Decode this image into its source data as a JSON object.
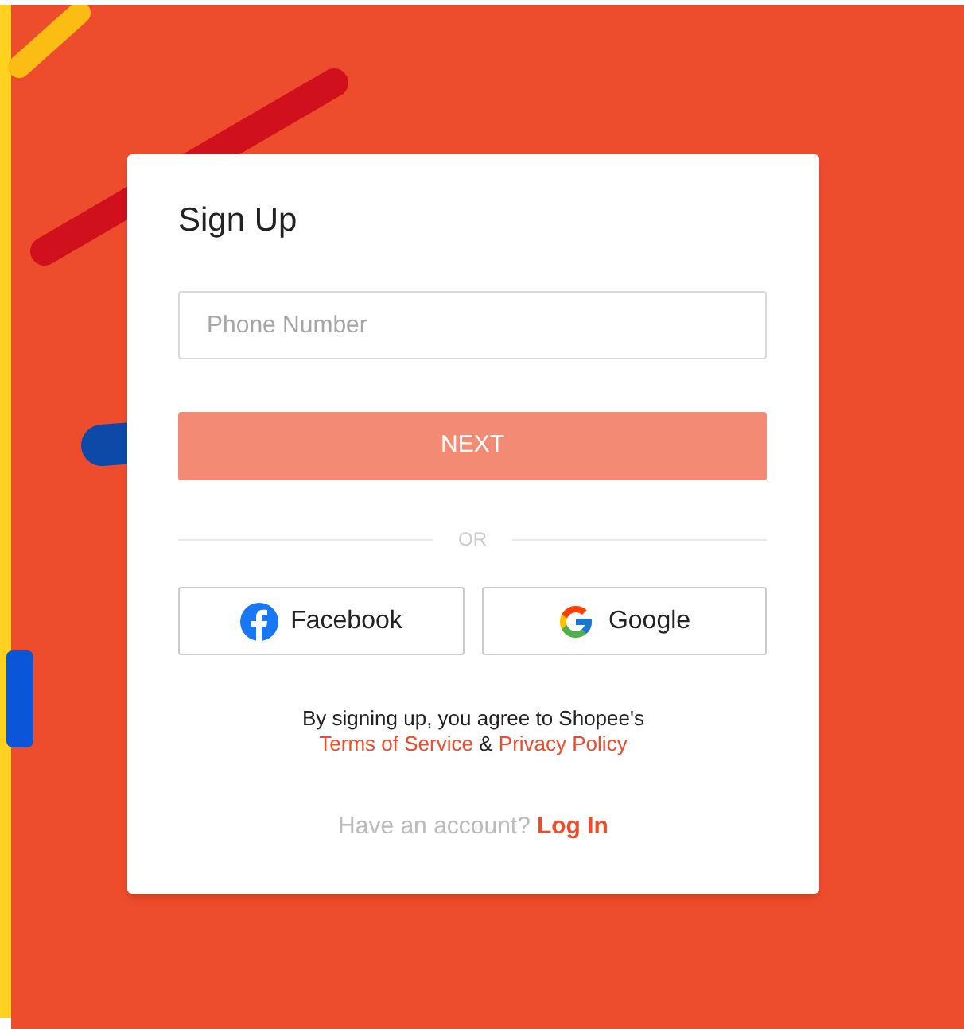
{
  "form": {
    "title": "Sign Up",
    "phone": {
      "placeholder": "Phone Number"
    },
    "next": {
      "label": "NEXT",
      "disabled": true
    },
    "divider": "OR",
    "social": [
      {
        "kind": "facebook",
        "label": "Facebook"
      },
      {
        "kind": "google",
        "label": "Google"
      }
    ],
    "terms": {
      "text": "By signing up, you agree to Shopee's",
      "links": [
        "Terms of Service",
        "Privacy Policy"
      ],
      "joiner": "&"
    },
    "login": {
      "text": "Have an account?",
      "link": "Log In"
    }
  }
}
